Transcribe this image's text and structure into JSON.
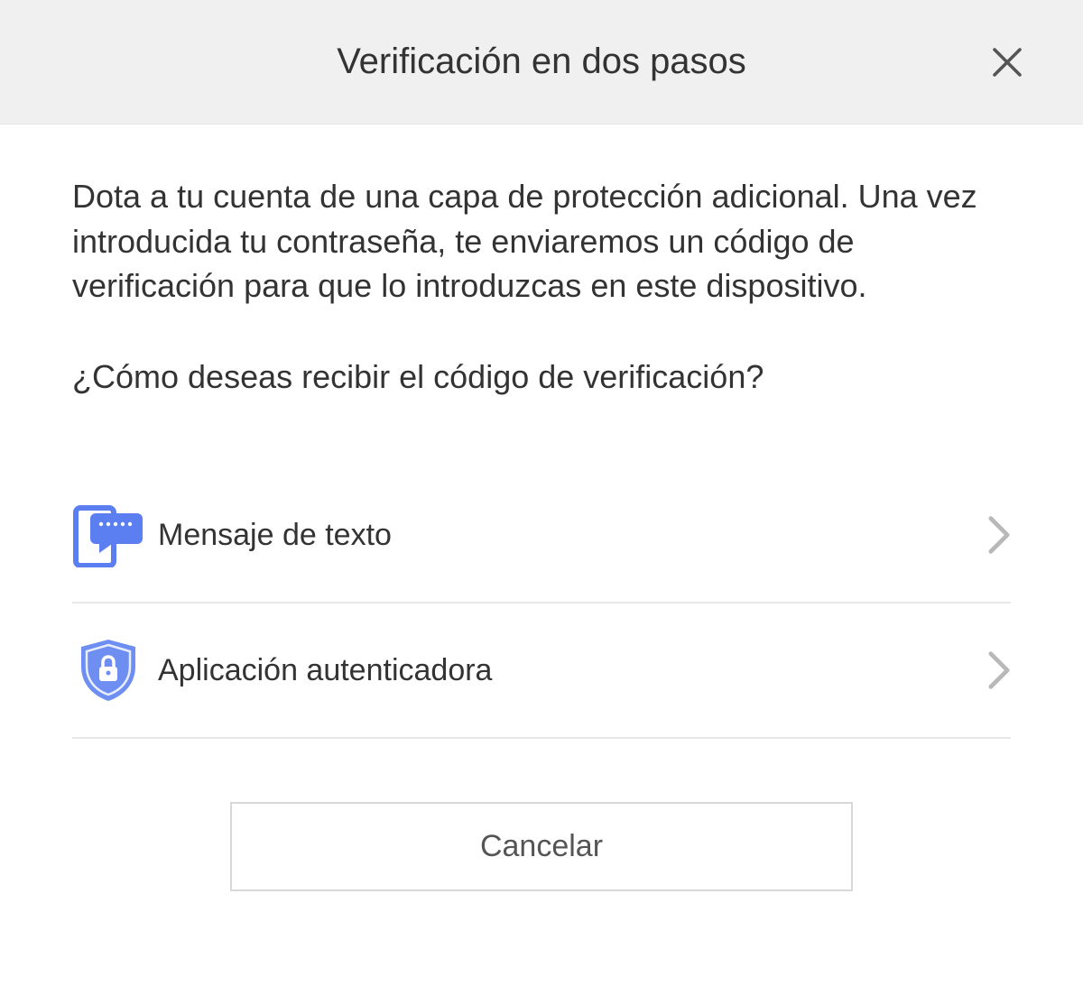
{
  "header": {
    "title": "Verificación en dos pasos"
  },
  "content": {
    "description": "Dota a tu cuenta de una capa de protección adicional. Una vez introducida tu contraseña, te enviaremos un código de verificación para que lo introduzcas en este dispositivo.",
    "question": "¿Cómo deseas recibir el código de verificación?"
  },
  "options": [
    {
      "label": "Mensaje de texto",
      "icon": "phone-message-icon"
    },
    {
      "label": "Aplicación autenticadora",
      "icon": "shield-lock-icon"
    }
  ],
  "footer": {
    "cancel_label": "Cancelar"
  },
  "colors": {
    "icon_primary": "#5b7ff0",
    "icon_light": "#a9baf6"
  }
}
